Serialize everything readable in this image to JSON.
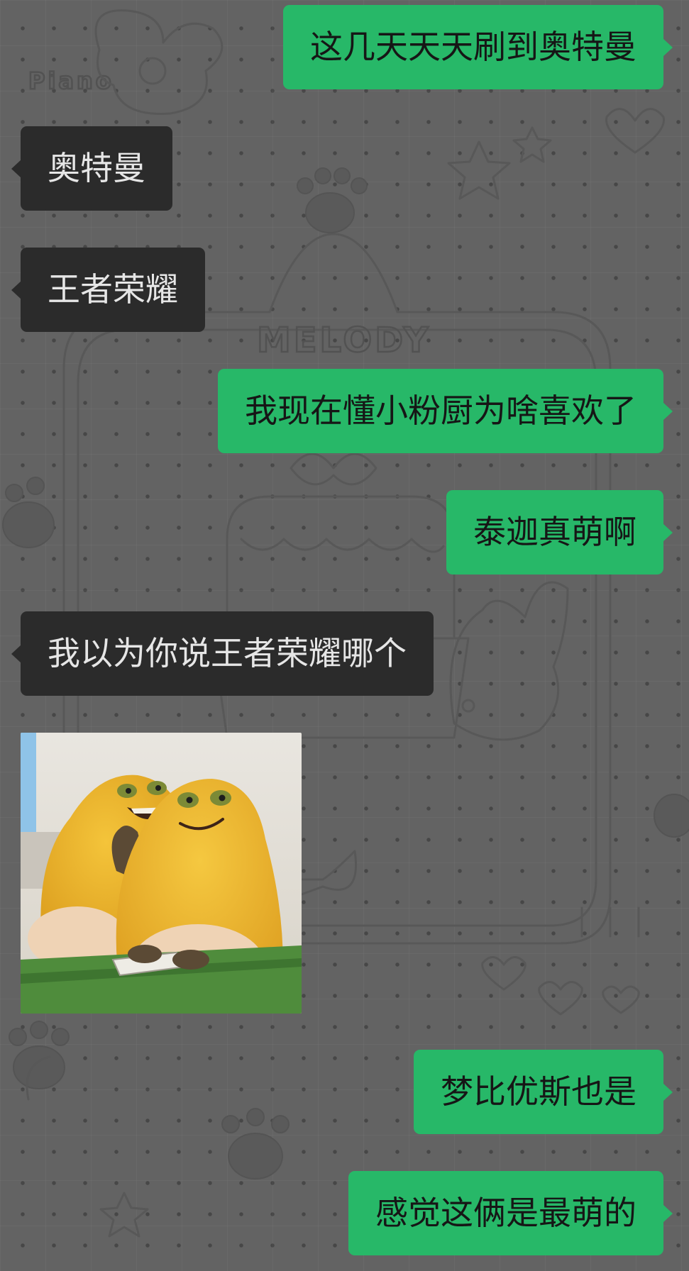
{
  "chat": {
    "messages": [
      {
        "direction": "sent",
        "text": "这几天天天刷到奥特曼"
      },
      {
        "direction": "received",
        "text": "奥特曼"
      },
      {
        "direction": "received",
        "text": "王者荣耀"
      },
      {
        "direction": "sent",
        "text": "我现在懂小粉厨为啥喜欢了"
      },
      {
        "direction": "sent",
        "text": "泰迦真萌啊"
      },
      {
        "direction": "received",
        "text": "我以为你说王者荣耀哪个"
      },
      {
        "direction": "received",
        "type": "sticker",
        "depicts": "two yellow cartoon creatures whispering at a green desk"
      },
      {
        "direction": "sent",
        "text": "梦比优斯也是"
      },
      {
        "direction": "sent",
        "text": "感觉这俩是最萌的"
      }
    ]
  },
  "wallpaper": {
    "logo_text": "MELODY",
    "corner_text": "Piano"
  },
  "colors": {
    "sent_bubble": "#27b868",
    "received_bubble": "#2b2b2b",
    "background": "#636363"
  }
}
